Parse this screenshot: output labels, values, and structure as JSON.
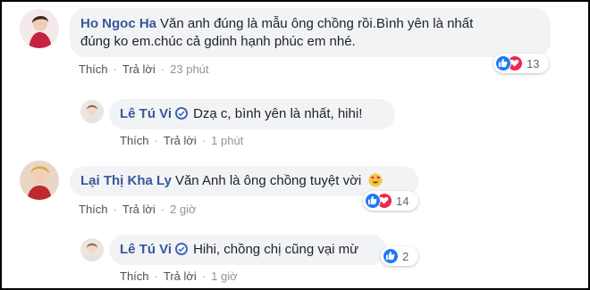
{
  "comments": [
    {
      "author": "Ho Ngoc Ha",
      "text_line1": "Văn anh đúng là mẫu ông chồng rồi.Bình yên là nhất",
      "text_line2": "đúng ko em.chúc cả gdinh hạnh phúc em nhé.",
      "like_label": "Thích",
      "reply_label": "Trả lời",
      "time": "23 phút",
      "reactions": [
        "like-icon",
        "love-icon"
      ],
      "reaction_count": "13"
    },
    {
      "author": "Lê Tú Vi",
      "verified": true,
      "text": "Dzạ c, bình yên là nhất, hihi!",
      "like_label": "Thích",
      "reply_label": "Trả lời",
      "time": "1 phút"
    },
    {
      "author": "Lại Thị Kha Ly",
      "text": "Văn Anh là ông chồng tuyệt vời",
      "emoji": "heart-eyes-emoji",
      "like_label": "Thích",
      "reply_label": "Trả lời",
      "time": "2 giờ",
      "reactions": [
        "like-icon",
        "love-icon"
      ],
      "reaction_count": "14"
    },
    {
      "author": "Lê Tú Vi",
      "verified": true,
      "text": "Hihi, chồng chị cũng vại mừ",
      "like_label": "Thích",
      "reply_label": "Trả lời",
      "time": "1 giờ",
      "reactions": [
        "like-icon"
      ],
      "reaction_count": "2"
    }
  ],
  "colors": {
    "author": "#385898",
    "bubble": "#f2f3f5",
    "like": "#2078f4",
    "love": "#f0284a"
  }
}
